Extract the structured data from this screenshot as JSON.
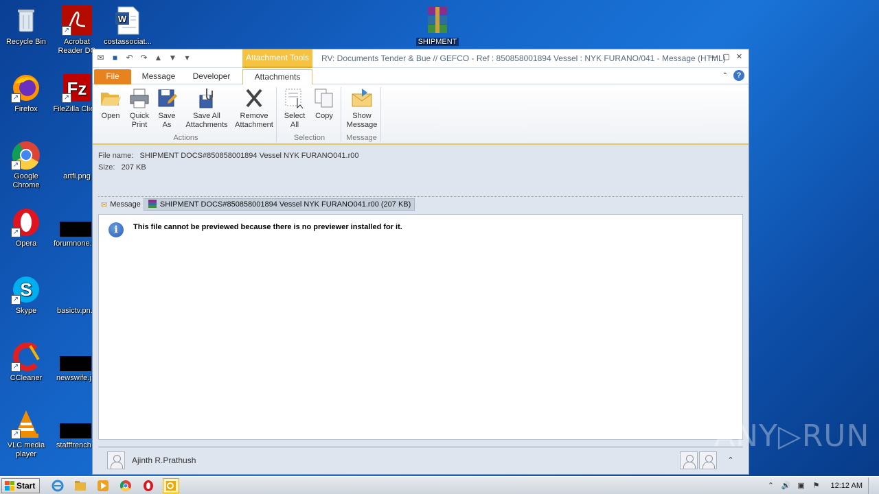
{
  "desktop": {
    "icons": [
      {
        "label": "Recycle Bin"
      },
      {
        "label": "Acrobat Reader DC"
      },
      {
        "label": "costassociat..."
      },
      {
        "label": "Firefox"
      },
      {
        "label": "FileZilla Client"
      },
      {
        "label": "Google Chrome"
      },
      {
        "label": "artfi.png"
      },
      {
        "label": "Opera"
      },
      {
        "label": "forumnone.r..."
      },
      {
        "label": "Skype"
      },
      {
        "label": "basictv.pn..."
      },
      {
        "label": "CCleaner"
      },
      {
        "label": "newswife.j..."
      },
      {
        "label": "VLC media player"
      },
      {
        "label": "stafffrench..."
      },
      {
        "label": "SHIPMENT"
      }
    ]
  },
  "window": {
    "context_tab": "Attachment Tools",
    "title": "RV: Documents Tender & Bue // GEFCO - Ref : 850858001894 Vessel : NYK FURANO/041  -  Message (HTML)",
    "tabs": [
      {
        "label": "File"
      },
      {
        "label": "Message"
      },
      {
        "label": "Developer"
      },
      {
        "label": "Attachments"
      }
    ],
    "ribbon": {
      "actions_label": "Actions",
      "selection_label": "Selection",
      "message_label": "Message",
      "open": "Open",
      "quick_print_1": "Quick",
      "quick_print_2": "Print",
      "save_as_1": "Save",
      "save_as_2": "As",
      "save_all_1": "Save All",
      "save_all_2": "Attachments",
      "remove_1": "Remove",
      "remove_2": "Attachment",
      "select_all_1": "Select",
      "select_all_2": "All",
      "copy": "Copy",
      "show_msg_1": "Show",
      "show_msg_2": "Message"
    },
    "attachment_info": {
      "file_name_label": "File name:",
      "file_name": "SHIPMENT DOCS#850858001894 Vessel  NYK FURANO041.r00",
      "size_label": "Size:",
      "size": "207 KB"
    },
    "attachment_bar": {
      "message_tab": "Message",
      "file_tab": "SHIPMENT DOCS#850858001894 Vessel  NYK FURANO041.r00 (207 KB)"
    },
    "preview_message": "This file cannot be previewed because there is no previewer installed for it.",
    "people_pane": {
      "name": "Ajinth R.Prathush"
    }
  },
  "taskbar": {
    "start_label": "Start",
    "clock": "12:12 AM"
  },
  "watermark": "ANY▷RUN"
}
